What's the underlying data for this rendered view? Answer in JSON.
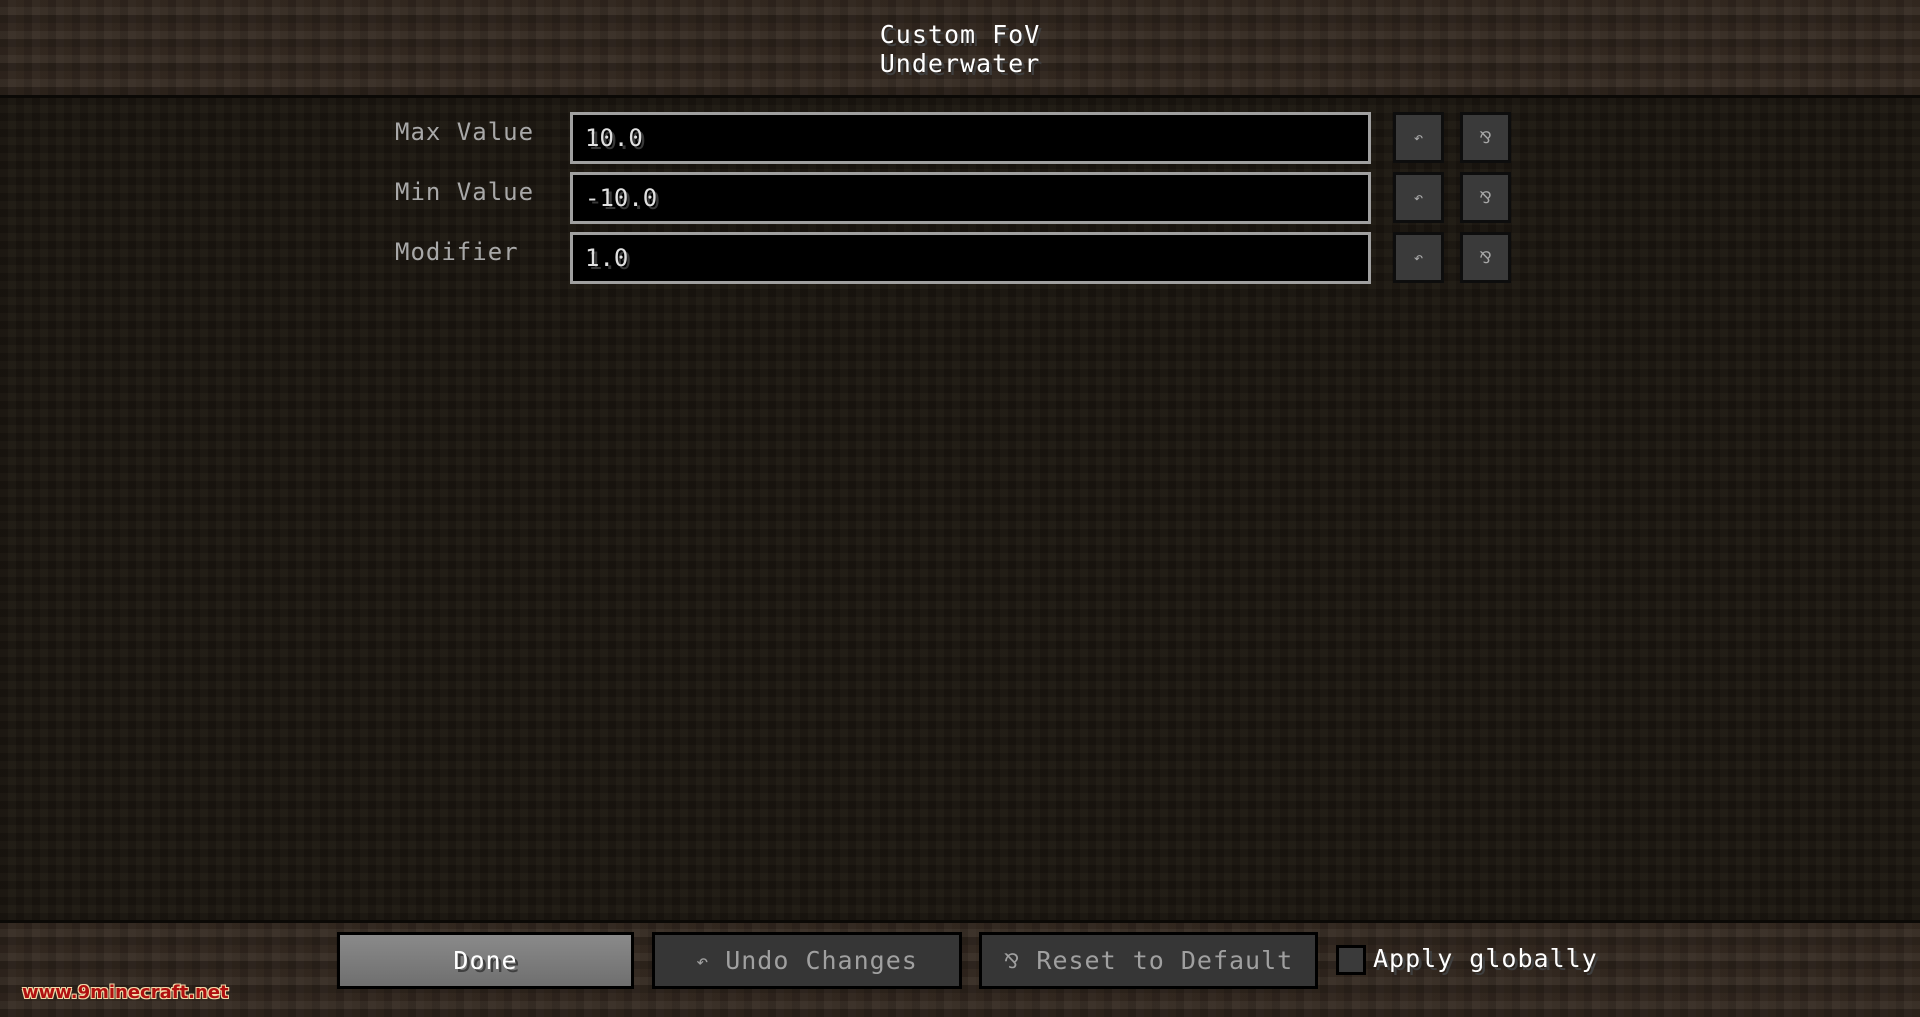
{
  "header": {
    "title": "Custom FoV",
    "subtitle": "Underwater"
  },
  "rows": [
    {
      "label": "Max Value",
      "value": "10.0",
      "undo_icon": "undo-arrow-icon",
      "reset_icon": "reset-default-icon"
    },
    {
      "label": "Min Value",
      "value": "-10.0",
      "undo_icon": "undo-arrow-icon",
      "reset_icon": "reset-default-icon"
    },
    {
      "label": "Modifier",
      "value": "1.0",
      "undo_icon": "undo-arrow-icon",
      "reset_icon": "reset-default-icon"
    }
  ],
  "icons": {
    "undo_glyph": "↶",
    "reset_glyph": "⅋"
  },
  "footer": {
    "done_label": "Done",
    "undo_label": "Undo Changes",
    "reset_label": "Reset to Default",
    "apply_globally_label": "Apply globally",
    "apply_globally_checked": false
  },
  "watermark": "www.9minecraft.net"
}
